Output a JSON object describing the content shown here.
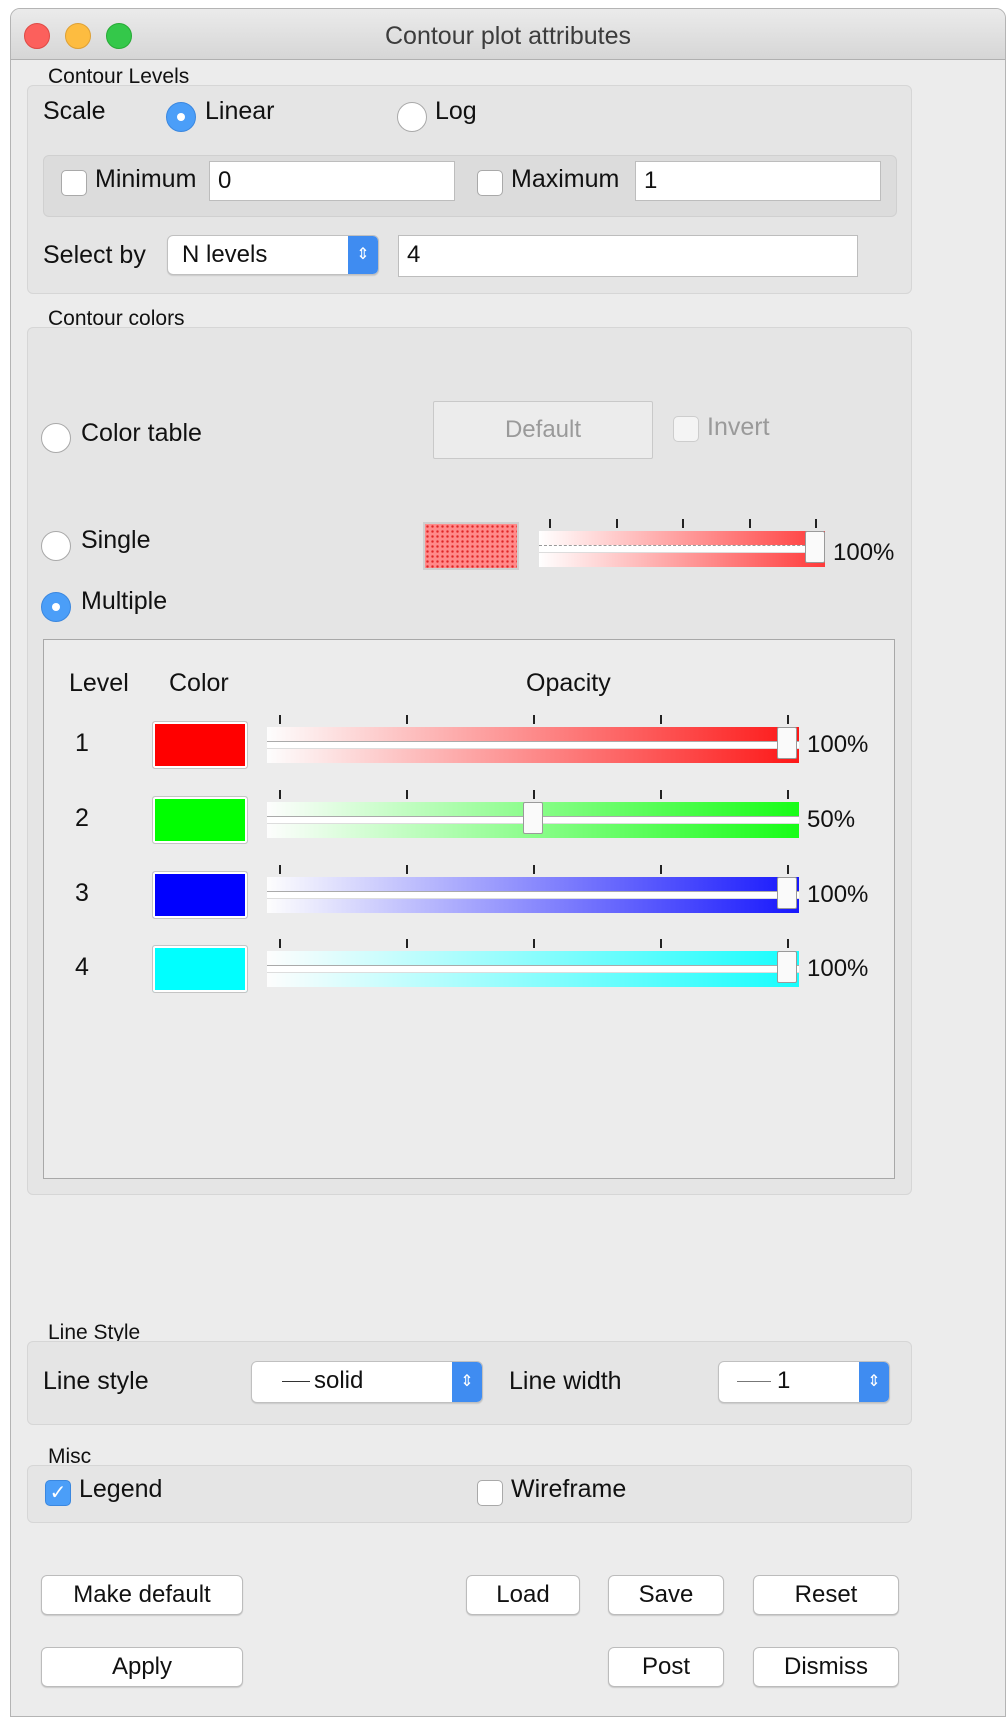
{
  "window": {
    "title": "Contour plot attributes"
  },
  "contour_levels": {
    "group_label": "Contour Levels",
    "scale_label": "Scale",
    "scale_options": [
      "Linear",
      "Log"
    ],
    "scale_selected": "Linear",
    "minimum": {
      "label": "Minimum",
      "checked": false,
      "value": "0"
    },
    "maximum": {
      "label": "Maximum",
      "checked": false,
      "value": "1"
    },
    "select_by": {
      "label": "Select by",
      "selected": "N levels",
      "value": "4"
    }
  },
  "contour_colors": {
    "group_label": "Contour colors",
    "mode_options": {
      "color_table": "Color table",
      "single": "Single",
      "multiple": "Multiple"
    },
    "mode_selected": "Multiple",
    "default_button": "Default",
    "invert_label": "Invert",
    "single_opacity": "100%",
    "single_opacity_value": 1.0,
    "headers": {
      "level": "Level",
      "color": "Color",
      "opacity": "Opacity"
    },
    "levels": [
      {
        "level": "1",
        "color": "#ff0000",
        "opacity_label": "100%",
        "opacity_value": 1.0
      },
      {
        "level": "2",
        "color": "#00ff00",
        "opacity_label": "50%",
        "opacity_value": 0.5
      },
      {
        "level": "3",
        "color": "#0000ff",
        "opacity_label": "100%",
        "opacity_value": 1.0
      },
      {
        "level": "4",
        "color": "#00ffff",
        "opacity_label": "100%",
        "opacity_value": 1.0
      }
    ]
  },
  "line_style": {
    "group_label": "Line Style",
    "style_label": "Line style",
    "style_value": "solid",
    "width_label": "Line width",
    "width_value": "1"
  },
  "misc": {
    "group_label": "Misc",
    "legend": {
      "label": "Legend",
      "checked": true
    },
    "wireframe": {
      "label": "Wireframe",
      "checked": false
    }
  },
  "buttons": {
    "make_default": "Make default",
    "load": "Load",
    "save": "Save",
    "reset": "Reset",
    "apply": "Apply",
    "post": "Post",
    "dismiss": "Dismiss"
  },
  "colors": {
    "accent": "#4b9ef8",
    "window_bg": "#ececec"
  }
}
